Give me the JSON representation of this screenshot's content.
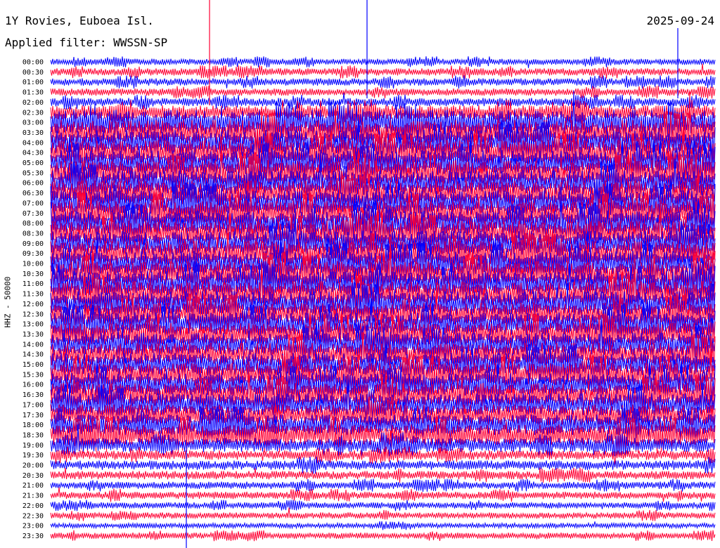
{
  "header": {
    "station": "1Y Rovies, Euboea Isl.",
    "filter": "Applied filter: WWSSN-SP",
    "date": "2025-09-24"
  },
  "chart_data": {
    "type": "line",
    "title": "1Y Rovies, Euboea Isl.",
    "subtitle": "Applied filter: WWSSN-SP",
    "date": "2025-09-24",
    "ylabel": "HHZ - 50000",
    "xlabel": "",
    "series_colors": [
      "#0000ff",
      "#ff0033"
    ],
    "rows": [
      {
        "time": "00:00",
        "activity": 0.15
      },
      {
        "time": "00:30",
        "activity": 0.2
      },
      {
        "time": "01:00",
        "activity": 0.2
      },
      {
        "time": "01:30",
        "activity": 0.2
      },
      {
        "time": "02:00",
        "activity": 0.25
      },
      {
        "time": "02:30",
        "activity": 0.5
      },
      {
        "time": "03:00",
        "activity": 1.0
      },
      {
        "time": "03:30",
        "activity": 1.0
      },
      {
        "time": "04:00",
        "activity": 1.0
      },
      {
        "time": "04:30",
        "activity": 1.0
      },
      {
        "time": "05:00",
        "activity": 1.0
      },
      {
        "time": "05:30",
        "activity": 1.0
      },
      {
        "time": "06:00",
        "activity": 1.0
      },
      {
        "time": "06:30",
        "activity": 1.0
      },
      {
        "time": "07:00",
        "activity": 1.0
      },
      {
        "time": "07:30",
        "activity": 1.0
      },
      {
        "time": "08:00",
        "activity": 1.0
      },
      {
        "time": "08:30",
        "activity": 1.0
      },
      {
        "time": "09:00",
        "activity": 1.0
      },
      {
        "time": "09:30",
        "activity": 1.0
      },
      {
        "time": "10:00",
        "activity": 1.0
      },
      {
        "time": "10:30",
        "activity": 1.0
      },
      {
        "time": "11:00",
        "activity": 1.0
      },
      {
        "time": "11:30",
        "activity": 1.0
      },
      {
        "time": "12:00",
        "activity": 1.0
      },
      {
        "time": "12:30",
        "activity": 0.9
      },
      {
        "time": "13:00",
        "activity": 0.9
      },
      {
        "time": "13:30",
        "activity": 0.9
      },
      {
        "time": "14:00",
        "activity": 0.9
      },
      {
        "time": "14:30",
        "activity": 0.9
      },
      {
        "time": "15:00",
        "activity": 0.9
      },
      {
        "time": "15:30",
        "activity": 0.9
      },
      {
        "time": "16:00",
        "activity": 0.9
      },
      {
        "time": "16:30",
        "activity": 0.9
      },
      {
        "time": "17:00",
        "activity": 0.9
      },
      {
        "time": "17:30",
        "activity": 0.8
      },
      {
        "time": "18:00",
        "activity": 0.8
      },
      {
        "time": "18:30",
        "activity": 0.8
      },
      {
        "time": "19:00",
        "activity": 0.5
      },
      {
        "time": "19:30",
        "activity": 0.3
      },
      {
        "time": "20:00",
        "activity": 0.3
      },
      {
        "time": "20:30",
        "activity": 0.25
      },
      {
        "time": "21:00",
        "activity": 0.2
      },
      {
        "time": "21:30",
        "activity": 0.2
      },
      {
        "time": "22:00",
        "activity": 0.15
      },
      {
        "time": "22:30",
        "activity": 0.15
      },
      {
        "time": "23:00",
        "activity": 0.1
      },
      {
        "time": "23:30",
        "activity": 0.15
      }
    ],
    "grid": false,
    "legend": "none"
  }
}
